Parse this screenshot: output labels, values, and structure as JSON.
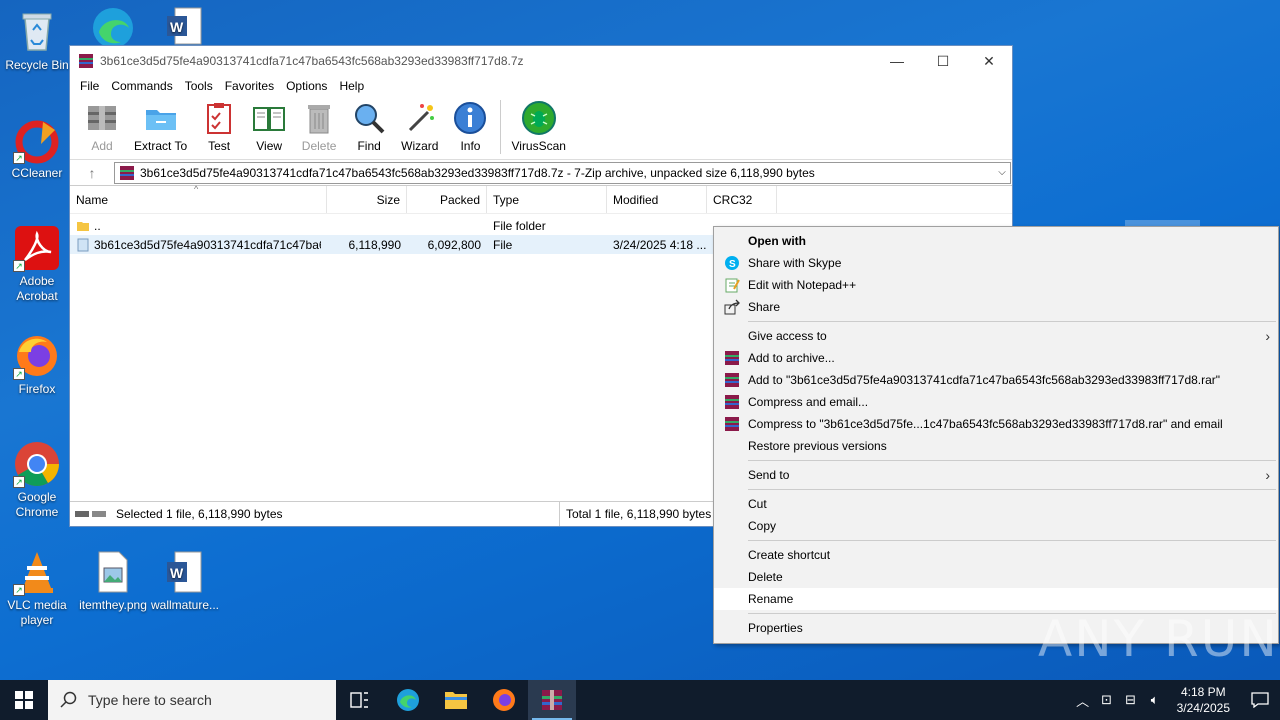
{
  "desktop": {
    "icons": [
      {
        "label": "Recycle Bin"
      },
      {
        "label": "CCleaner"
      },
      {
        "label": "Adobe Acrobat"
      },
      {
        "label": "Firefox"
      },
      {
        "label": "Google Chrome"
      },
      {
        "label": "VLC media player"
      },
      {
        "label": "itemthey.png"
      },
      {
        "label": "wallmature..."
      }
    ]
  },
  "window": {
    "title": "3b61ce3d5d75fe4a90313741cdfa71c47ba6543fc568ab3293ed33983ff717d8.7z",
    "menu": [
      "File",
      "Commands",
      "Tools",
      "Favorites",
      "Options",
      "Help"
    ],
    "toolbar": [
      {
        "label": "Add",
        "icon": "add-archive-icon",
        "disabled": true
      },
      {
        "label": "Extract To",
        "icon": "extract-folder-icon",
        "disabled": false
      },
      {
        "label": "Test",
        "icon": "test-clipboard-icon",
        "disabled": false
      },
      {
        "label": "View",
        "icon": "view-book-icon",
        "disabled": false
      },
      {
        "label": "Delete",
        "icon": "trash-icon",
        "disabled": true
      },
      {
        "label": "Find",
        "icon": "magnifier-icon",
        "disabled": false
      },
      {
        "label": "Wizard",
        "icon": "wand-icon",
        "disabled": false
      },
      {
        "label": "Info",
        "icon": "info-icon",
        "disabled": false
      },
      {
        "label": "VirusScan",
        "icon": "virus-scan-icon",
        "disabled": false
      }
    ],
    "address": "3b61ce3d5d75fe4a90313741cdfa71c47ba6543fc568ab3293ed33983ff717d8.7z - 7-Zip archive, unpacked size 6,118,990 bytes",
    "columns": [
      "Name",
      "Size",
      "Packed",
      "Type",
      "Modified",
      "CRC32"
    ],
    "rows": [
      {
        "name": "..",
        "size": "",
        "packed": "",
        "type": "File folder",
        "modified": "",
        "crc": ""
      },
      {
        "name": "3b61ce3d5d75fe4a90313741cdfa71c47ba65...",
        "size": "6,118,990",
        "packed": "6,092,800",
        "type": "File",
        "modified": "3/24/2025 4:18 ...",
        "crc": ""
      }
    ],
    "status_left": "Selected 1 file, 6,118,990 bytes",
    "status_right": "Total 1 file, 6,118,990 bytes"
  },
  "context_menu": {
    "open_with": "Open with",
    "share_skype": "Share with Skype",
    "edit_notepad": "Edit with Notepad++",
    "share": "Share",
    "give_access": "Give access to",
    "add_archive": "Add to archive...",
    "add_to_rar": "Add to \"3b61ce3d5d75fe4a90313741cdfa71c47ba6543fc568ab3293ed33983ff717d8.rar\"",
    "compress_email": "Compress and email...",
    "compress_rar_email": "Compress to \"3b61ce3d5d75fe...1c47ba6543fc568ab3293ed33983ff717d8.rar\" and email",
    "restore": "Restore previous versions",
    "send_to": "Send to",
    "cut": "Cut",
    "copy": "Copy",
    "create_shortcut": "Create shortcut",
    "delete": "Delete",
    "rename": "Rename",
    "properties": "Properties"
  },
  "taskbar": {
    "search_placeholder": "Type here to search",
    "time": "4:18 PM",
    "date": "3/24/2025"
  },
  "watermark": "ANY RUN"
}
